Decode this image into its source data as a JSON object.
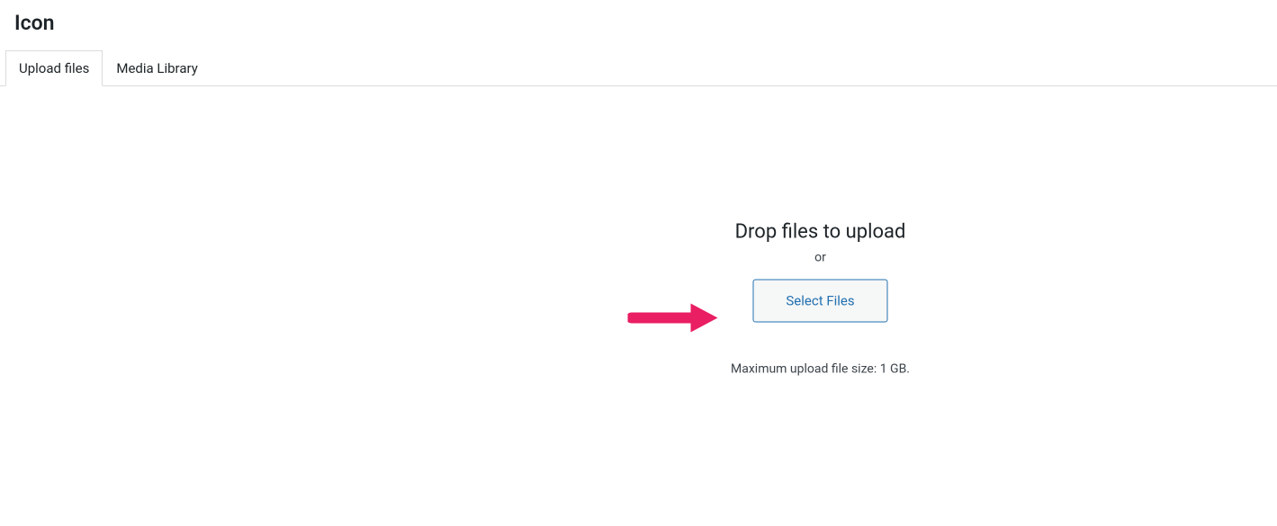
{
  "header": {
    "title": "Icon"
  },
  "tabs": {
    "items": [
      {
        "label": "Upload files",
        "active": true
      },
      {
        "label": "Media Library",
        "active": false
      }
    ]
  },
  "uploader": {
    "drop_instructions": "Drop files to upload",
    "or_text": "or",
    "select_button_label": "Select Files",
    "max_upload_text": "Maximum upload file size: 1 GB."
  },
  "annotation": {
    "arrow_color": "#e91e63"
  }
}
